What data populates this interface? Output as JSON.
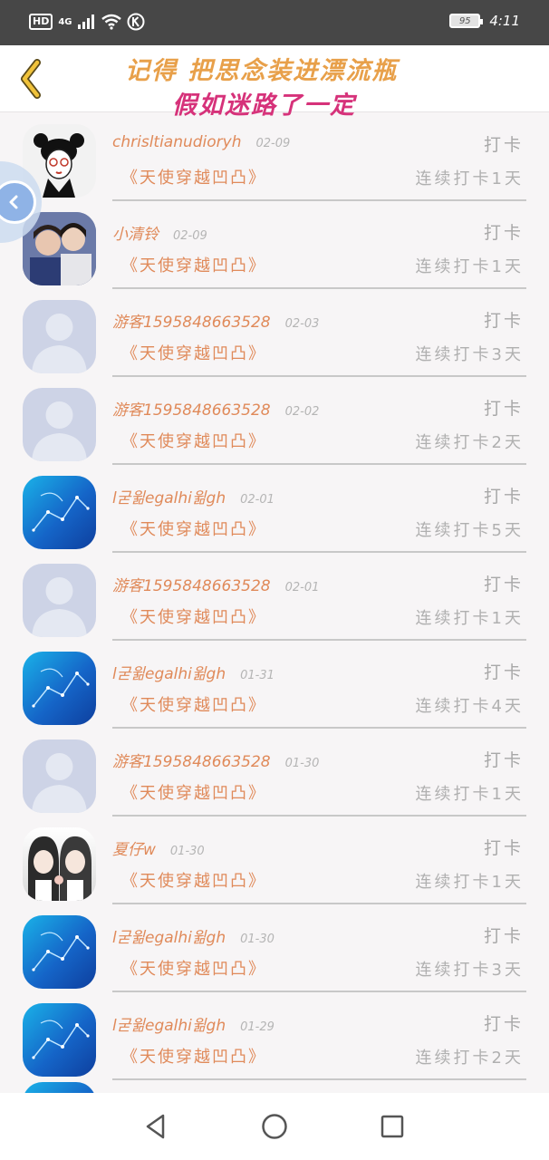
{
  "status_bar": {
    "network": "HD",
    "signal": "4G",
    "battery": "95",
    "time": "4:11"
  },
  "header": {
    "title_line1": "记得 把思念装进漂流瓶",
    "title_line2": "假如迷路了一定"
  },
  "list": {
    "checkin_label": "打卡",
    "rows": [
      {
        "name": "chrisltianudioryh",
        "date": "02-09",
        "book": "《天使穿越凹凸》",
        "streak": "连续打卡1天",
        "avatar": "cartoon"
      },
      {
        "name": "小清铃",
        "date": "02-09",
        "book": "《天使穿越凹凸》",
        "streak": "连续打卡1天",
        "avatar": "photo"
      },
      {
        "name": "游客1595848663528",
        "date": "02-03",
        "book": "《天使穿越凹凸》",
        "streak": "连续打卡3天",
        "avatar": "default"
      },
      {
        "name": "游客1595848663528",
        "date": "02-02",
        "book": "《天使穿越凹凸》",
        "streak": "连续打卡2天",
        "avatar": "default"
      },
      {
        "name": "l굳윎egalhi윎gh",
        "date": "02-01",
        "book": "《天使穿越凹凸》",
        "streak": "连续打卡5天",
        "avatar": "blue"
      },
      {
        "name": "游客1595848663528",
        "date": "02-01",
        "book": "《天使穿越凹凸》",
        "streak": "连续打卡1天",
        "avatar": "default"
      },
      {
        "name": "l굳윎egalhi윎gh",
        "date": "01-31",
        "book": "《天使穿越凹凸》",
        "streak": "连续打卡4天",
        "avatar": "blue"
      },
      {
        "name": "游客1595848663528",
        "date": "01-30",
        "book": "《天使穿越凹凸》",
        "streak": "连续打卡1天",
        "avatar": "default"
      },
      {
        "name": "夏仔w",
        "date": "01-30",
        "book": "《天使穿越凹凸》",
        "streak": "连续打卡1天",
        "avatar": "maids"
      },
      {
        "name": "l굳윎egalhi윎gh",
        "date": "01-30",
        "book": "《天使穿越凹凸》",
        "streak": "连续打卡3天",
        "avatar": "blue"
      },
      {
        "name": "l굳윎egalhi윎gh",
        "date": "01-29",
        "book": "《天使穿越凹凸》",
        "streak": "连续打卡2天",
        "avatar": "blue"
      }
    ]
  },
  "icons": {
    "back": "chevron-left-icon",
    "float": "collapse-icon",
    "nav_back": "triangle-back-icon",
    "nav_home": "circle-home-icon",
    "nav_recent": "square-recent-icon"
  },
  "colors": {
    "accent_orange": "#e08a5a",
    "title_pink": "#d6327a",
    "title_gold": "#e8a04a"
  }
}
